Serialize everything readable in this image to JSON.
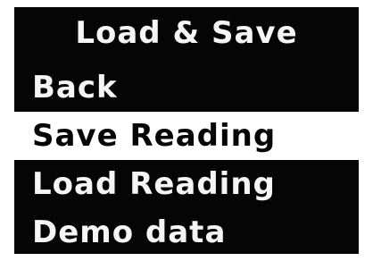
{
  "screen": {
    "title": "Load & Save"
  },
  "menu": {
    "items": [
      {
        "label": "Back",
        "selected": false
      },
      {
        "label": "Save Reading",
        "selected": true
      },
      {
        "label": "Load Reading",
        "selected": false
      },
      {
        "label": "Demo data",
        "selected": false
      }
    ]
  },
  "colors": {
    "background": "#050505",
    "foreground": "#f5f5f5",
    "selection_background": "#ffffff",
    "selection_foreground": "#050505"
  }
}
